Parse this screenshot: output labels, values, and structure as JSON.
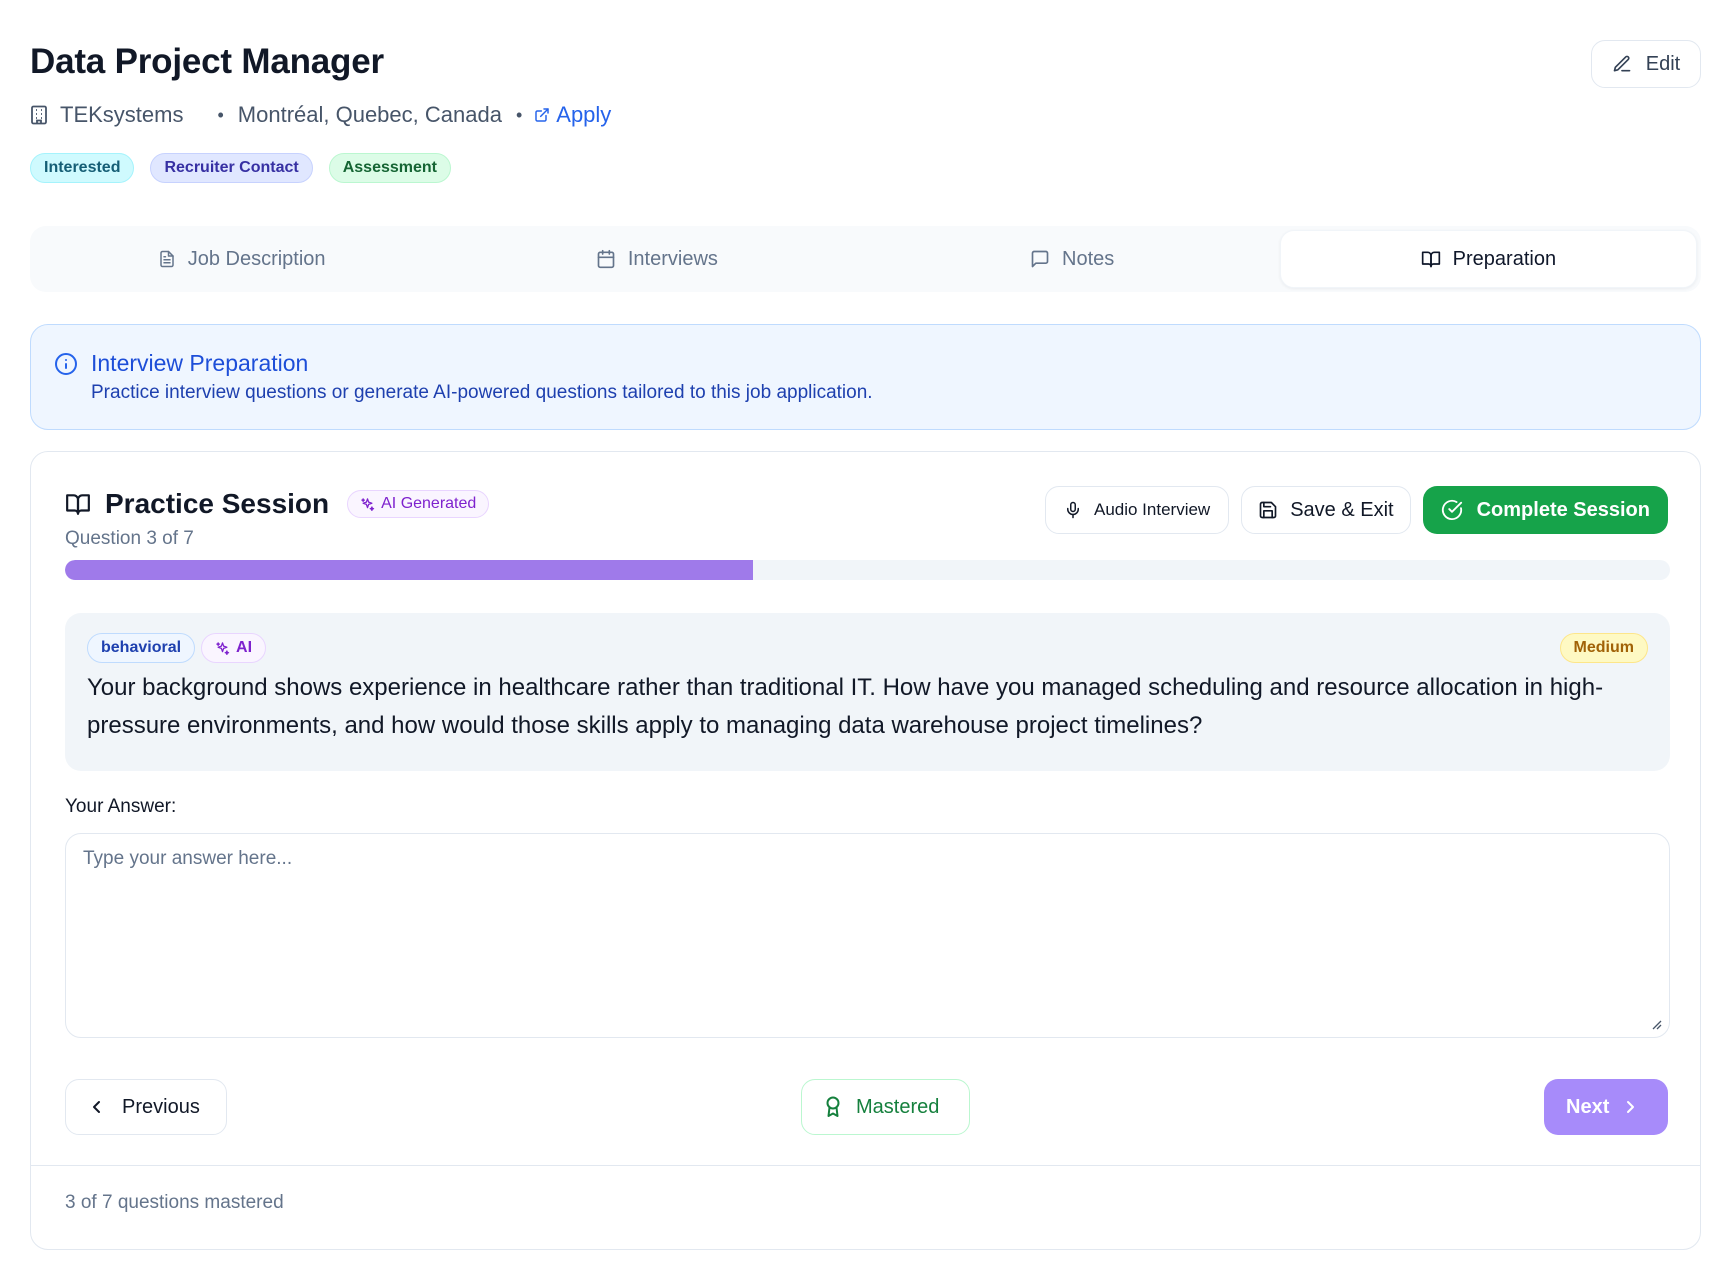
{
  "header": {
    "title": "Data Project Manager",
    "edit_label": "Edit",
    "company": "TEKsystems",
    "location": "Montréal, Quebec, Canada",
    "apply_label": "Apply",
    "separator": "•",
    "badges": [
      "Interested",
      "Recruiter Contact",
      "Assessment"
    ]
  },
  "tabs": [
    {
      "label": "Job Description",
      "icon": "document-icon"
    },
    {
      "label": "Interviews",
      "icon": "calendar-icon"
    },
    {
      "label": "Notes",
      "icon": "message-icon"
    },
    {
      "label": "Preparation",
      "icon": "book-open-icon",
      "active": true
    }
  ],
  "info": {
    "title": "Interview Preparation",
    "text": "Practice interview questions or generate AI-powered questions tailored to this job application."
  },
  "session": {
    "title": "Practice Session",
    "ai_badge": "AI Generated",
    "question_counter": "Question 3 of 7",
    "progress_fraction": 0.4286,
    "audio_label": "Audio Interview",
    "save_label": "Save & Exit",
    "complete_label": "Complete Session",
    "question": {
      "category": "behavioral",
      "ai_tag": "AI",
      "difficulty": "Medium",
      "text": "Your background shows experience in healthcare rather than traditional IT. How have you managed scheduling and resource allocation in high-pressure environments, and how would those skills apply to managing data warehouse project timelines?"
    },
    "answer_label": "Your Answer:",
    "answer_placeholder": "Type your answer here...",
    "answer_value": "",
    "prev_label": "Previous",
    "mastered_label": "Mastered",
    "next_label": "Next",
    "mastered_count": "3 of 7 questions mastered"
  },
  "colors": {
    "accent_purple": "#a78bfa",
    "progress_fill": "#9f7aea",
    "complete_green": "#16a34a",
    "info_blue": "#1d4ed8"
  }
}
